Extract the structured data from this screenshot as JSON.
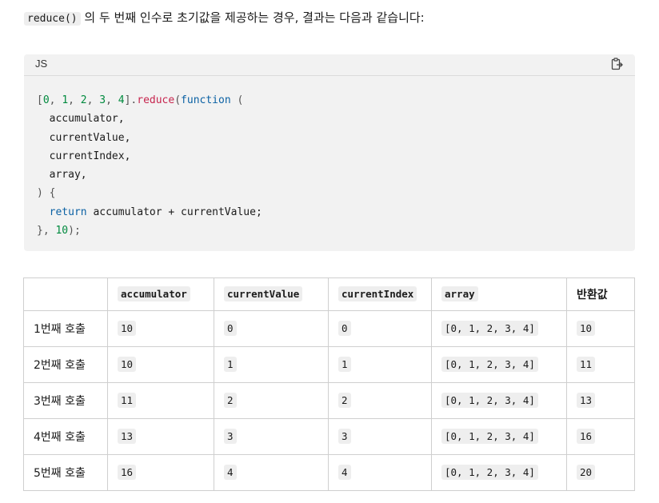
{
  "intro": {
    "code": "reduce()",
    "text": " 의 두 번째 인수로 초기값을 제공하는 경우, 결과는 다음과 같습니다:"
  },
  "code_block": {
    "language": "JS",
    "copy_icon": "clipboard-icon",
    "tokens": {
      "open_bracket": "[",
      "n0": "0",
      "c1": ", ",
      "n1": "1",
      "c2": ", ",
      "n2": "2",
      "c3": ", ",
      "n3": "3",
      "c4": ", ",
      "n4": "4",
      "close_bracket": "]",
      "dot": ".",
      "method": "reduce",
      "paren_open": "(",
      "keyword_function": "function",
      "space_paren": " (",
      "param1": "  accumulator,",
      "param2": "  currentValue,",
      "param3": "  currentIndex,",
      "param4": "  array,",
      "close_params": ") {",
      "indent": "  ",
      "keyword_return": "return",
      "return_expr": " accumulator + currentValue;",
      "close_fn": "}, ",
      "initial": "10",
      "close_call": ");"
    }
  },
  "table": {
    "headers": [
      "",
      "accumulator",
      "currentValue",
      "currentIndex",
      "array",
      "반환값"
    ],
    "rows": [
      {
        "call": "1번째 호출",
        "accumulator": "10",
        "currentValue": "0",
        "currentIndex": "0",
        "array": "[0, 1, 2, 3, 4]",
        "return": "10"
      },
      {
        "call": "2번째 호출",
        "accumulator": "10",
        "currentValue": "1",
        "currentIndex": "1",
        "array": "[0, 1, 2, 3, 4]",
        "return": "11"
      },
      {
        "call": "3번째 호출",
        "accumulator": "11",
        "currentValue": "2",
        "currentIndex": "2",
        "array": "[0, 1, 2, 3, 4]",
        "return": "13"
      },
      {
        "call": "4번째 호출",
        "accumulator": "13",
        "currentValue": "3",
        "currentIndex": "3",
        "array": "[0, 1, 2, 3, 4]",
        "return": "16"
      },
      {
        "call": "5번째 호출",
        "accumulator": "16",
        "currentValue": "4",
        "currentIndex": "4",
        "array": "[0, 1, 2, 3, 4]",
        "return": "20"
      }
    ]
  }
}
